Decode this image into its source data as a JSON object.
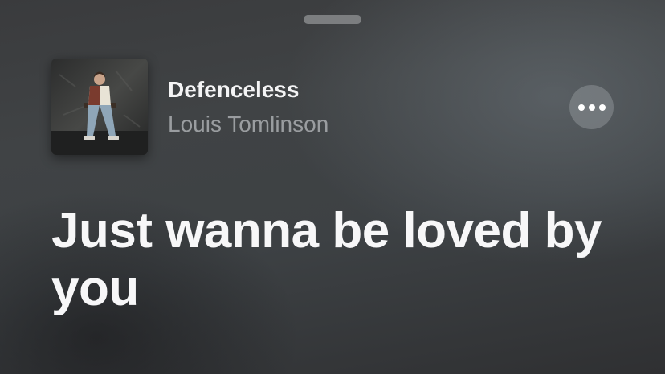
{
  "now_playing": {
    "title": "Defenceless",
    "artist": "Louis Tomlinson",
    "artwork_icon": "album-cover-icon"
  },
  "more_button": {
    "icon": "ellipsis-icon"
  },
  "lyrics": {
    "current_line": "Just wanna be loved by you"
  },
  "colors": {
    "title": "#f4f4f5",
    "artist": "#9a9da0",
    "lyric": "#f7f7f8",
    "background": "#3d4144"
  }
}
